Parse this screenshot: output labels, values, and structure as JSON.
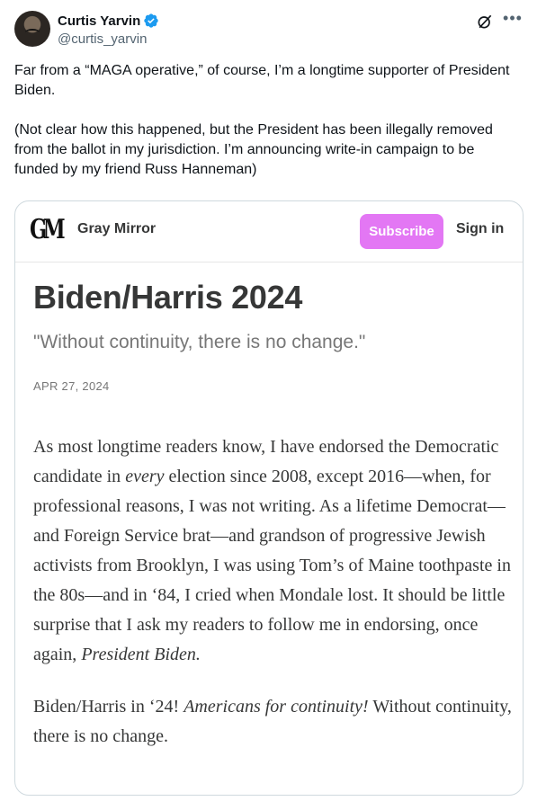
{
  "author": {
    "display_name": "Curtis Yarvin",
    "handle": "@curtis_yarvin"
  },
  "icons": {
    "verified": "verified-badge-icon",
    "grok": "grok-icon",
    "more": "more-icon"
  },
  "tweet": {
    "paragraph1": "Far from a “MAGA operative,” of course, I’m a longtime supporter of President Biden.",
    "paragraph2": "(Not clear how this happened, but the President has been illegally removed from the ballot in my jurisdiction. I’m announcing write-in campaign to be funded by my friend Russ Hanneman)"
  },
  "card": {
    "logo_text": "GM",
    "publication": "Gray Mirror",
    "subscribe_label": "Subscribe",
    "signin_label": "Sign in",
    "title": "Biden/Harris 2024",
    "subtitle": "\"Without continuity, there is no change.\"",
    "date": "APR 27, 2024",
    "body": {
      "p1_a": "As most longtime readers know, I have endorsed the Democratic candidate in ",
      "p1_em1": "every",
      "p1_b": " election since 2008, except 2016—when, for professional reasons, I was not writing. As a lifetime Democrat—and Foreign Service brat—and grandson of progressive Jewish activists from Brooklyn, I was using Tom’s of Maine toothpaste in the 80s—and in ‘84, I cried when Mondale lost. It should be little surprise that I ask my readers to follow me in endorsing, once again, ",
      "p1_em2": "President Biden.",
      "p2_a": "Biden/Harris in ‘24! ",
      "p2_em": "Americans for continuity!",
      "p2_b": " Without continuity, there is no change."
    }
  },
  "colors": {
    "verified": "#1d9bf0",
    "subscribe_bg": "#e377f4",
    "text_primary": "#0f1419",
    "text_secondary": "#536471"
  }
}
